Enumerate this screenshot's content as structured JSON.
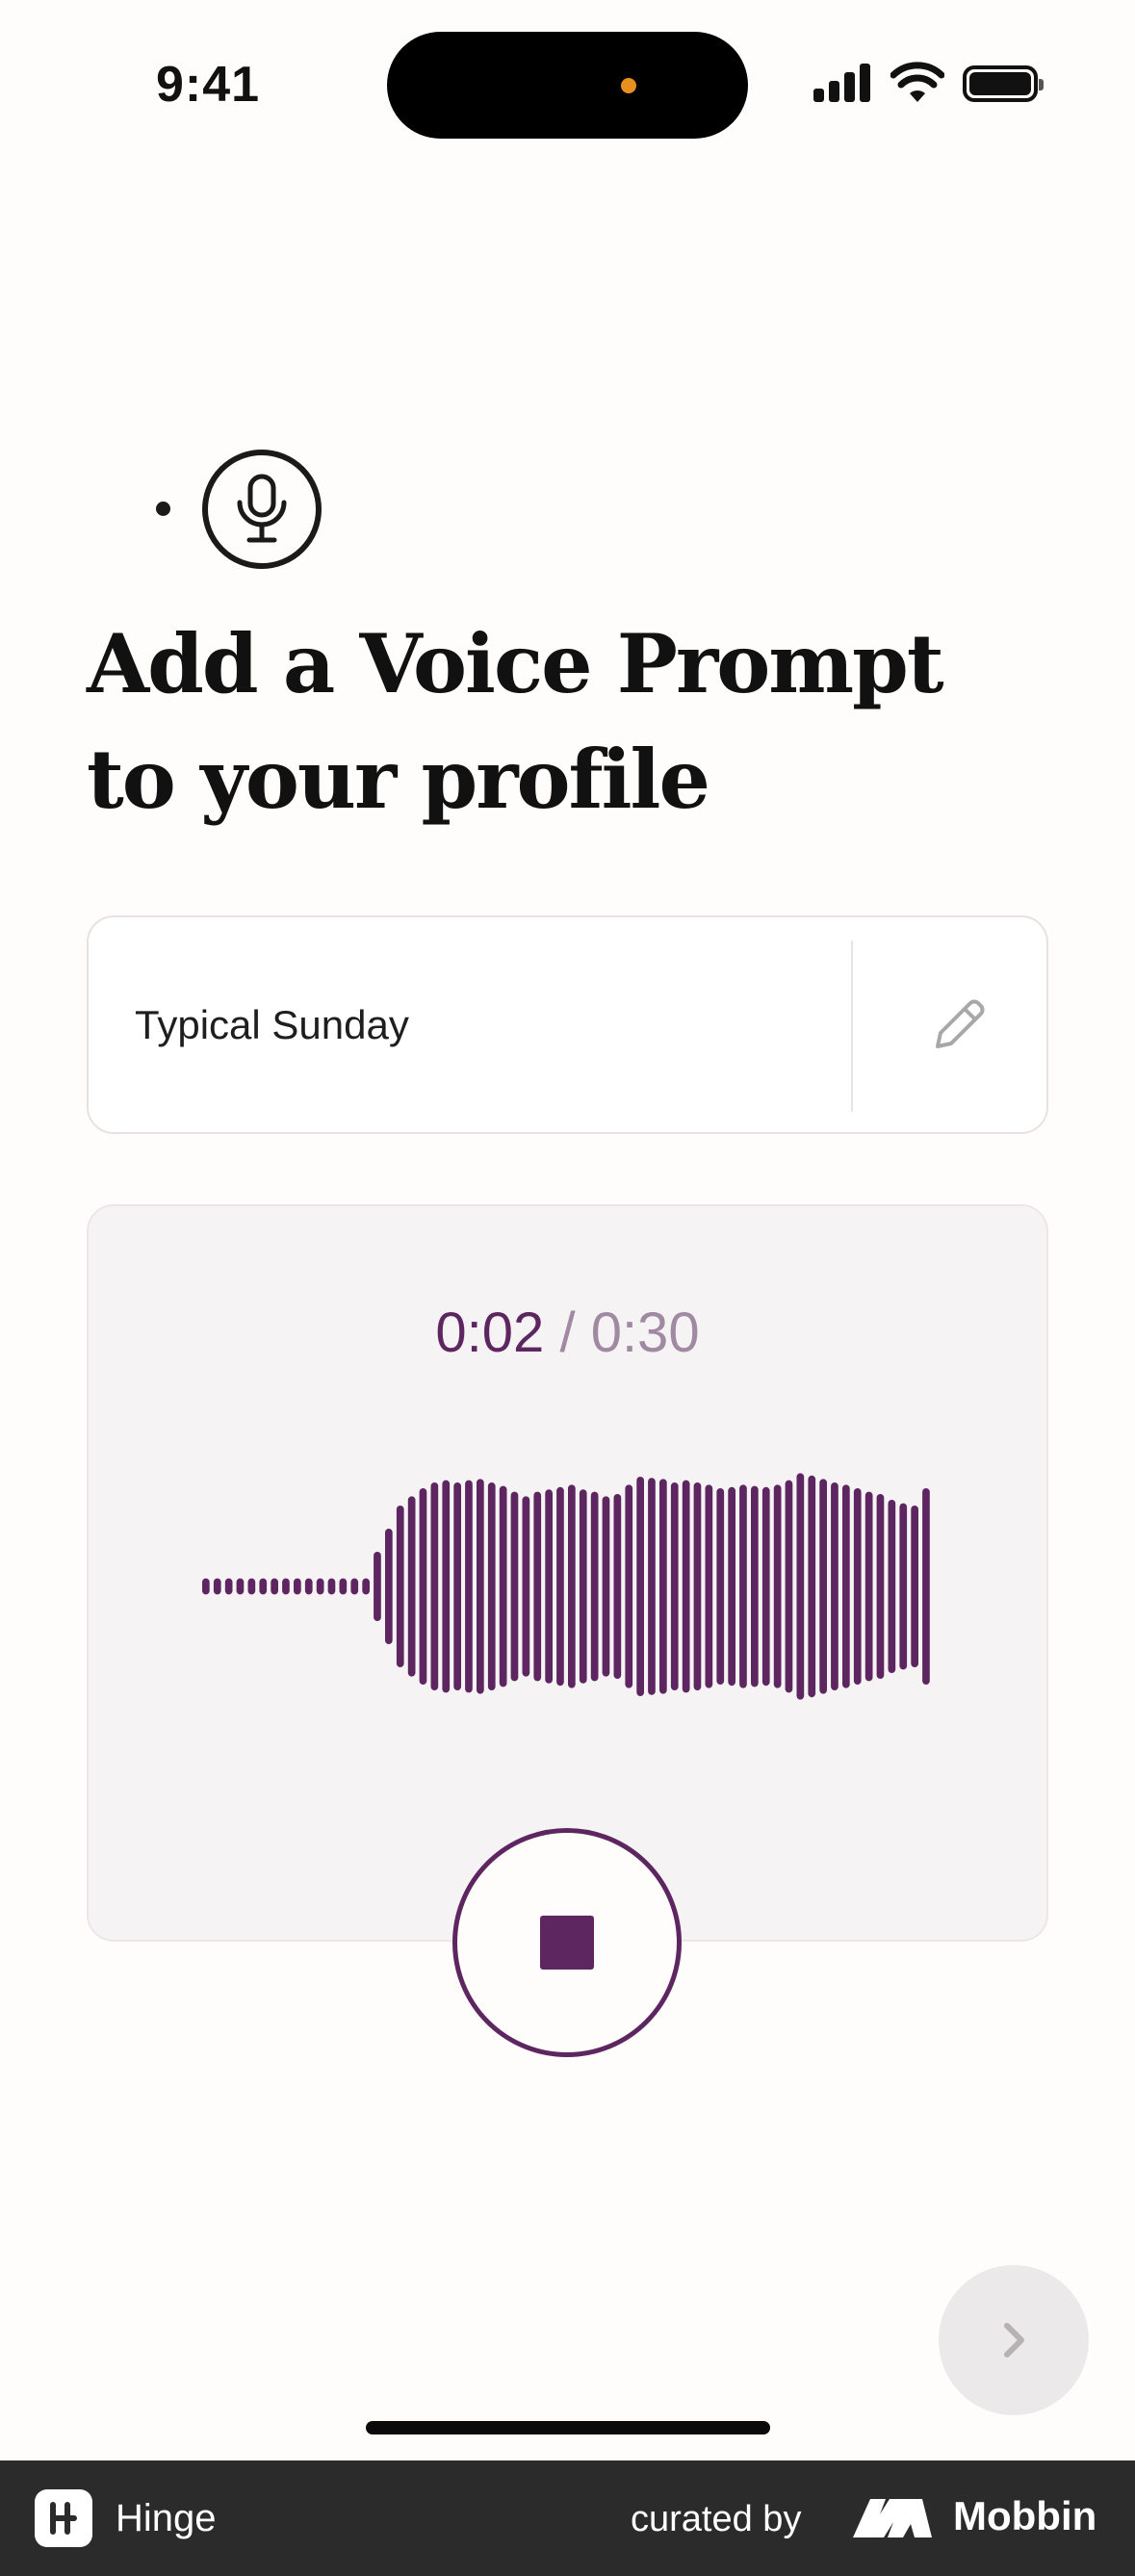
{
  "status_bar": {
    "time": "9:41"
  },
  "header": {
    "icon": "microphone-icon",
    "title": "Add a Voice Prompt to your profile"
  },
  "prompt_card": {
    "prompt": "Typical Sunday",
    "edit_icon": "pencil-icon"
  },
  "recorder": {
    "elapsed": "0:02",
    "separator": "/",
    "total": "0:30",
    "state": "recording",
    "waveform_levels": [
      0.07,
      0.07,
      0.07,
      0.07,
      0.07,
      0.07,
      0.07,
      0.07,
      0.07,
      0.07,
      0.07,
      0.07,
      0.07,
      0.07,
      0.07,
      0.3,
      0.5,
      0.7,
      0.78,
      0.85,
      0.9,
      0.92,
      0.9,
      0.92,
      0.93,
      0.9,
      0.87,
      0.82,
      0.78,
      0.82,
      0.84,
      0.86,
      0.88,
      0.84,
      0.82,
      0.78,
      0.8,
      0.88,
      0.95,
      0.94,
      0.93,
      0.9,
      0.92,
      0.9,
      0.88,
      0.85,
      0.86,
      0.88,
      0.87,
      0.86,
      0.88,
      0.92,
      0.98,
      0.96,
      0.93,
      0.9,
      0.88,
      0.85,
      0.82,
      0.8,
      0.75,
      0.72,
      0.7,
      0.85
    ],
    "stop_icon": "stop-icon",
    "accent_color": "#5d2660"
  },
  "navigation": {
    "next_icon": "chevron-right-icon"
  },
  "footer": {
    "app_name": "Hinge",
    "curated_by": "curated by",
    "brand": "Mobbin"
  }
}
